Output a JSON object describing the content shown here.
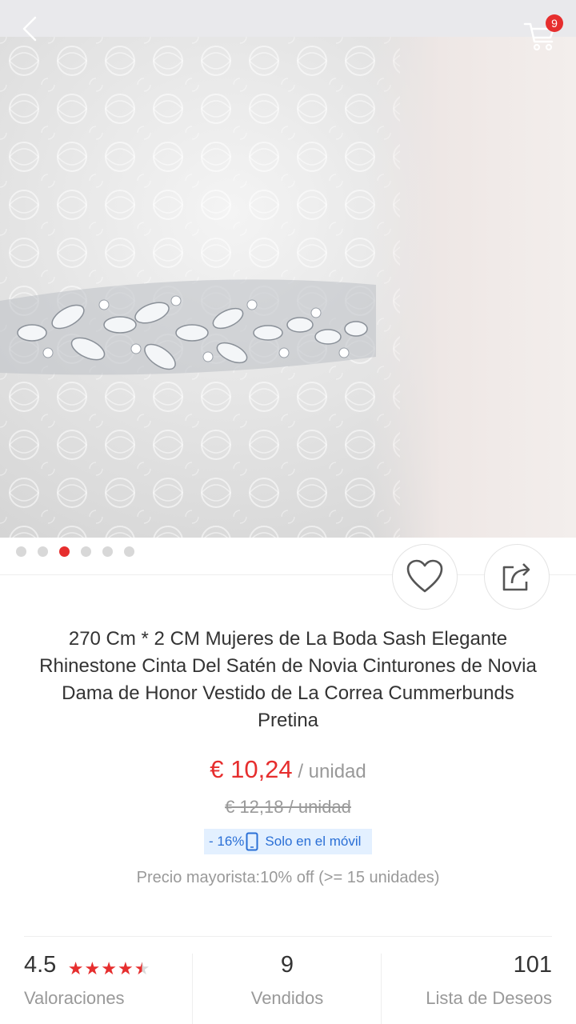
{
  "header": {
    "cart_count": "9"
  },
  "gallery": {
    "total": 6,
    "active_index": 2
  },
  "product": {
    "title": "270 Cm * 2 CM Mujeres de La Boda Sash Elegante Rhinestone Cinta Del Satén de Novia Cinturones de Novia Dama de Honor Vestido de La Correa Cummerbunds Pretina",
    "price": "€ 10,24",
    "price_unit": " / unidad",
    "old_price": "€ 12,18 / unidad",
    "discount": "- 16%",
    "mobile_only": "Solo en el móvil",
    "wholesale": "Precio mayorista:10% off (>= 15 unidades)"
  },
  "stats": {
    "rating": "4.5",
    "rating_label": "Valoraciones",
    "sold": "9",
    "sold_label": "Vendidos",
    "wishlist": "101",
    "wishlist_label": "Lista de Deseos"
  },
  "colors": {
    "accent": "#e62e2e",
    "badge_bg": "#e3f0ff",
    "badge_text": "#2a6fd6"
  },
  "icons": [
    "back-arrow-icon",
    "cart-icon",
    "heart-icon",
    "share-icon",
    "phone-icon",
    "star-icon"
  ]
}
